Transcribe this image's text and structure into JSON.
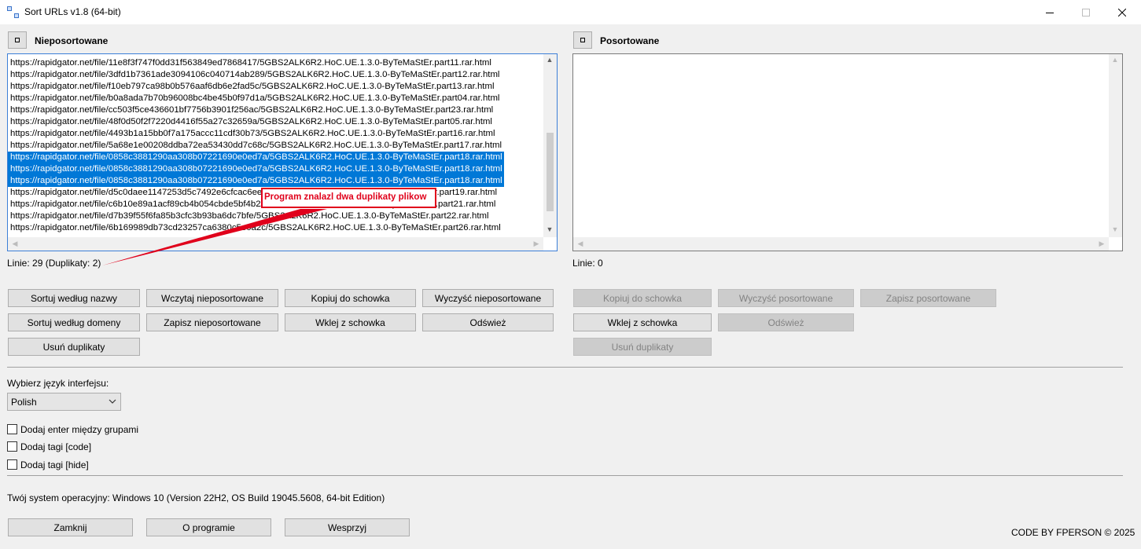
{
  "window": {
    "title": "Sort URLs v1.8 (64-bit)",
    "icon": "app-icon",
    "controls": [
      "minimize-icon",
      "maximize-icon",
      "close-icon"
    ]
  },
  "left": {
    "header_icon": "square-icon",
    "title": "Nieposortowane",
    "lines": [
      "https://rapidgator.net/file/11e8f3f747f0dd31f563849ed7868417/5GBS2ALK6R2.HoC.UE.1.3.0-ByTeMaStEr.part11.rar.html",
      "https://rapidgator.net/file/3dfd1b7361ade3094106c040714ab289/5GBS2ALK6R2.HoC.UE.1.3.0-ByTeMaStEr.part12.rar.html",
      "https://rapidgator.net/file/f10eb797ca98b0b576aaf6db6e2fad5c/5GBS2ALK6R2.HoC.UE.1.3.0-ByTeMaStEr.part13.rar.html",
      "https://rapidgator.net/file/b0a8ada7b70b96008bc4be45b0f97d1a/5GBS2ALK6R2.HoC.UE.1.3.0-ByTeMaStEr.part04.rar.html",
      "https://rapidgator.net/file/cc503f5ce436601bf7756b3901f256ac/5GBS2ALK6R2.HoC.UE.1.3.0-ByTeMaStEr.part23.rar.html",
      "https://rapidgator.net/file/48f0d50f2f7220d4416f55a27c32659a/5GBS2ALK6R2.HoC.UE.1.3.0-ByTeMaStEr.part05.rar.html",
      "https://rapidgator.net/file/4493b1a15bb0f7a175accc11cdf30b73/5GBS2ALK6R2.HoC.UE.1.3.0-ByTeMaStEr.part16.rar.html",
      "https://rapidgator.net/file/5a68e1e00208ddba72ea53430dd7c68c/5GBS2ALK6R2.HoC.UE.1.3.0-ByTeMaStEr.part17.rar.html",
      "https://rapidgator.net/file/0858c3881290aa308b07221690e0ed7a/5GBS2ALK6R2.HoC.UE.1.3.0-ByTeMaStEr.part18.rar.html",
      "https://rapidgator.net/file/0858c3881290aa308b07221690e0ed7a/5GBS2ALK6R2.HoC.UE.1.3.0-ByTeMaStEr.part18.rar.html",
      "https://rapidgator.net/file/0858c3881290aa308b07221690e0ed7a/5GBS2ALK6R2.HoC.UE.1.3.0-ByTeMaStEr.part18.rar.html",
      "https://rapidgator.net/file/d5c0daee1147253d5c7492e6cfcac6ee/5GBS2ALK6R2.HoC.UE.1.3.0-ByTeMaStEr.part19.rar.html",
      "https://rapidgator.net/file/c6b10e89a1acf89cb4b054cbde5bf4b2/5GBS2ALK6R2.HoC.UE.1.3.0-ByTeMaStEr.part21.rar.html",
      "https://rapidgator.net/file/d7b39f55f6fa85b3cfc3b93ba6dc7bfe/5GBS2ALK6R2.HoC.UE.1.3.0-ByTeMaStEr.part22.rar.html",
      "https://rapidgator.net/file/6b169989db73cd23257ca6380c5e0a2c/5GBS2ALK6R2.HoC.UE.1.3.0-ByTeMaStEr.part26.rar.html"
    ],
    "selected_rows": [
      8,
      9,
      10
    ],
    "status": "Linie: 29 (Duplikaty: 2)",
    "buttons": {
      "sort_name": "Sortuj według nazwy",
      "load_unsorted": "Wczytaj nieposortowane",
      "copy_clipboard": "Kopiuj do schowka",
      "clear_unsorted": "Wyczyść nieposortowane",
      "sort_domain": "Sortuj według domeny",
      "save_unsorted": "Zapisz nieposortowane",
      "paste_clipboard": "Wklej z schowka",
      "refresh": "Odśwież",
      "remove_duplicates": "Usuń duplikaty"
    }
  },
  "right": {
    "header_icon": "square-icon",
    "title": "Posortowane",
    "status": "Linie: 0",
    "buttons": {
      "copy_clipboard": "Kopiuj do schowka",
      "clear_sorted": "Wyczyść posortowane",
      "save_sorted": "Zapisz posortowane",
      "paste_clipboard": "Wklej z schowka",
      "refresh": "Odśwież",
      "remove_duplicates": "Usuń duplikaty"
    }
  },
  "annotation": {
    "text": "Program znalazl dwa duplikaty plikow",
    "color": "#e0001b"
  },
  "language": {
    "label": "Wybierz język interfejsu:",
    "selected": "Polish"
  },
  "options": [
    {
      "label": "Dodaj enter między grupami",
      "checked": false
    },
    {
      "label": "Dodaj tagi [code]",
      "checked": false
    },
    {
      "label": "Dodaj tagi [hide]",
      "checked": false
    }
  ],
  "system": {
    "label": "Twój system operacyjny:",
    "value": "Windows 10 (Version 22H2, OS Build 19045.5608, 64-bit Edition)"
  },
  "footer": {
    "close": "Zamknij",
    "about": "O programie",
    "support": "Wesprzyj",
    "credit": "CODE BY FPERSON © 2025"
  },
  "colors": {
    "selection": "#0078d7",
    "focus_border": "#3c7fd7"
  }
}
